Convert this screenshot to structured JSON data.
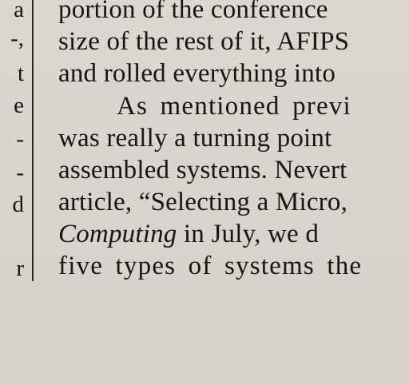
{
  "left_column": {
    "lines": [
      "a",
      "-,",
      "t",
      "e",
      "-",
      "-",
      "d",
      "r"
    ]
  },
  "right_column": {
    "lines": [
      {
        "text": "portion of the conference"
      },
      {
        "text": "size of the rest of it, AFIPS"
      },
      {
        "text": "and rolled everything into"
      },
      {
        "text": "As mentioned previ"
      },
      {
        "text": "was really a turning point"
      },
      {
        "text": "assembled systems. Nevert"
      },
      {
        "text": "article, “Selecting a Micro,"
      },
      {
        "italic": "Computing",
        "rest": " in July, we d"
      },
      {
        "text": "five types of systems the"
      }
    ]
  }
}
